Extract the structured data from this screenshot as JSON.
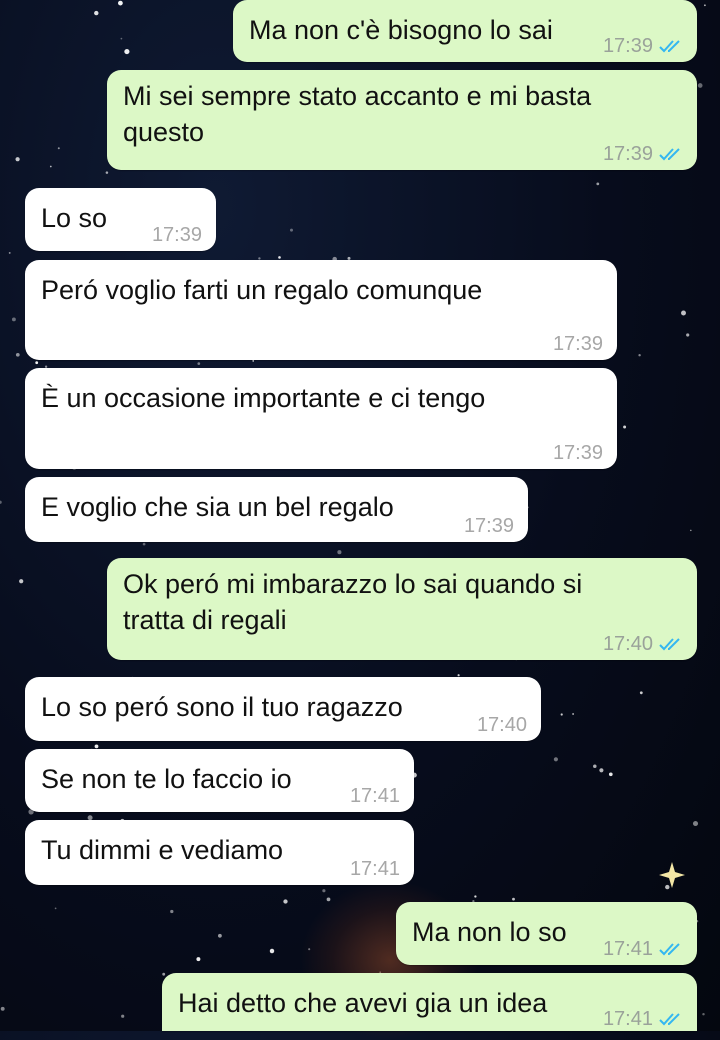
{
  "theme": {
    "outgoing_bg": "#dcf8c6",
    "incoming_bg": "#ffffff",
    "read_tick_color": "#34b7f1"
  },
  "messages": [
    {
      "direction": "out",
      "text": "Ma non c'è bisogno lo sai",
      "time": "17:39",
      "status": "read"
    },
    {
      "direction": "out",
      "text": "Mi sei sempre stato accanto e mi basta questo",
      "time": "17:39",
      "status": "read"
    },
    {
      "direction": "in",
      "text": "Lo so",
      "time": "17:39"
    },
    {
      "direction": "in",
      "text": "Peró voglio farti un regalo comunque",
      "time": "17:39"
    },
    {
      "direction": "in",
      "text": "È un occasione importante e ci tengo",
      "time": "17:39"
    },
    {
      "direction": "in",
      "text": "E voglio che sia un bel regalo",
      "time": "17:39"
    },
    {
      "direction": "out",
      "text": "Ok peró mi imbarazzo lo sai quando si tratta di regali",
      "time": "17:40",
      "status": "read"
    },
    {
      "direction": "in",
      "text": "Lo so peró sono il tuo ragazzo",
      "time": "17:40"
    },
    {
      "direction": "in",
      "text": "Se non te lo faccio io",
      "time": "17:41"
    },
    {
      "direction": "in",
      "text": "Tu dimmi e vediamo",
      "time": "17:41"
    },
    {
      "direction": "out",
      "text": "Ma non lo so",
      "time": "17:41",
      "status": "read"
    },
    {
      "direction": "out",
      "text": "Hai detto che avevi gia un idea",
      "time": "17:41",
      "status": "read"
    }
  ]
}
